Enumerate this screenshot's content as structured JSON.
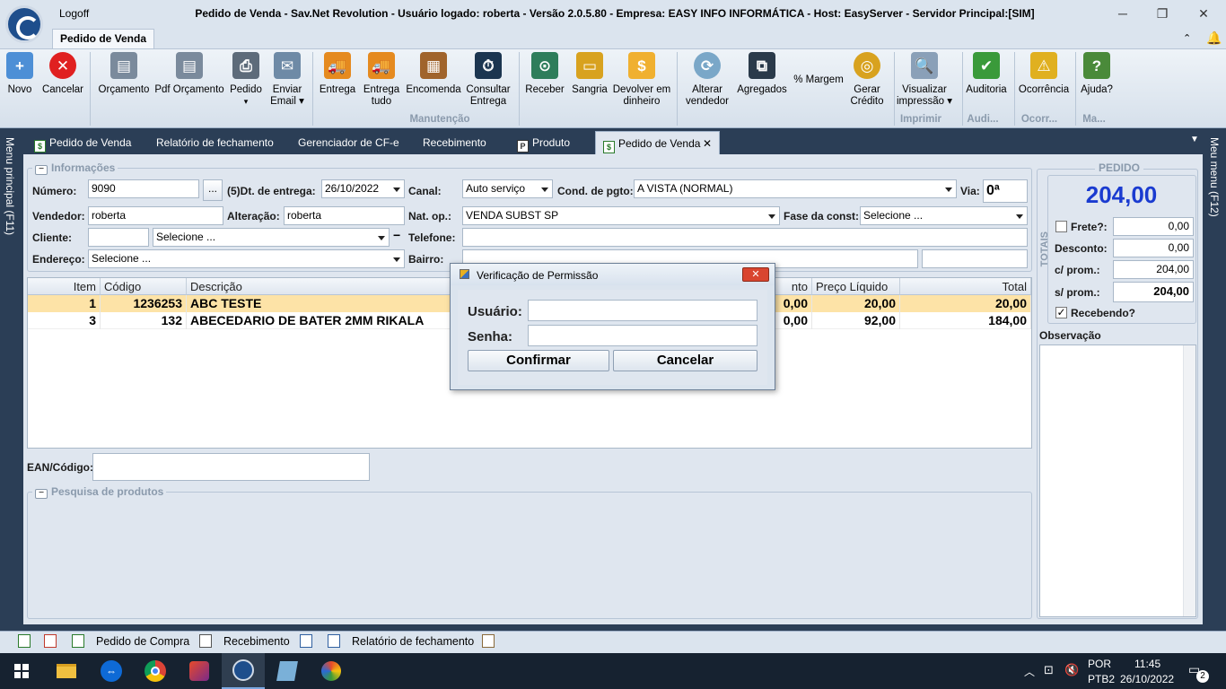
{
  "titlebar": {
    "logoff": "Logoff",
    "title": "Pedido de Venda - Sav.Net Revolution - Usuário logado: roberta - Versão 2.0.5.80 - Empresa: EASY INFO INFORMÁTICA - Host: EasyServer - Servidor Principal:[SIM]",
    "minimize": "─",
    "restore": "❐",
    "close": "✕"
  },
  "ribbon": {
    "tab": "Pedido de Venda",
    "buttons": {
      "novo": "Novo",
      "cancelar": "Cancelar",
      "orcamento": "Orçamento",
      "pdf_orcamento": "Pdf Orçamento",
      "pedido": "Pedido",
      "enviar_email_1": "Enviar",
      "enviar_email_2": "Email ▾",
      "entrega": "Entrega",
      "entrega_tudo_1": "Entrega",
      "entrega_tudo_2": "tudo",
      "encomenda": "Encomenda",
      "consultar_1": "Consultar",
      "consultar_2": "Entrega",
      "receber": "Receber",
      "sangria": "Sangria",
      "devolver_1": "Devolver em",
      "devolver_2": "dinheiro",
      "alterar_1": "Alterar",
      "alterar_2": "vendedor",
      "agregados": "Agregados",
      "margem": "% Margem",
      "gerar_1": "Gerar",
      "gerar_2": "Crédito",
      "visualizar_1": "Visualizar",
      "visualizar_2": "impressão ▾",
      "auditoria": "Auditoria",
      "ocorrencia": "Ocorrência",
      "ajuda": "Ajuda?"
    },
    "groups": {
      "manutencao": "Manutenção",
      "imprimir": "Imprimir",
      "audi": "Audi...",
      "ocorr": "Ocorr...",
      "ma": "Ma..."
    }
  },
  "side": {
    "left": "Menu principal (F11)",
    "right": "Meu menu (F12)"
  },
  "doctabs": [
    "Pedido de Venda",
    "Relatório de fechamento",
    "Gerenciador de CF-e",
    "Recebimento",
    "Produto",
    "Pedido de Venda"
  ],
  "informacoes": {
    "title": "Informações",
    "numero_label": "Número:",
    "numero": "9090",
    "dots": "...",
    "dt_entrega_label": "(5)Dt. de entrega:",
    "dt_entrega": "26/10/2022",
    "canal_label": "Canal:",
    "canal": "Auto serviço",
    "cond_label": "Cond. de pgto:",
    "cond": "A VISTA (NORMAL)",
    "via_label": "Via:",
    "via": "0ª",
    "vendedor_label": "Vendedor:",
    "vendedor": "roberta",
    "alteracao_label": "Alteração:",
    "alteracao": "roberta",
    "natop_label": "Nat. op.:",
    "natop": "VENDA SUBST SP",
    "fase_label": "Fase da const:",
    "fase": "Selecione ...",
    "cliente_label": "Cliente:",
    "cliente": "",
    "cliente_sel": "Selecione ...",
    "telefone_label": "Telefone:",
    "telefone": "",
    "endereco_label": "Endereço:",
    "endereco": "Selecione ...",
    "bairro_label": "Bairro:",
    "bairro": ""
  },
  "grid": {
    "headers": [
      "Item",
      "Código",
      "Descrição",
      "nto",
      "Preço Líquido",
      "Total"
    ],
    "rows": [
      [
        "1",
        "1236253",
        "ABC TESTE",
        "0,00",
        "20,00",
        "20,00"
      ],
      [
        "3",
        "132",
        "ABECEDARIO DE BATER 2MM RIKALA",
        "0,00",
        "92,00",
        "184,00"
      ]
    ]
  },
  "ean": {
    "label": "EAN/Código:",
    "value": ""
  },
  "pesquisa": {
    "title": "Pesquisa de produtos"
  },
  "dialog": {
    "title": "Verificação de Permissão",
    "usuario_label": "Usuário:",
    "senha_label": "Senha:",
    "usuario": "",
    "senha": "",
    "confirmar": "Confirmar",
    "cancelar": "Cancelar"
  },
  "pedido": {
    "title": "PEDIDO",
    "total": "204,00",
    "totais_label": "TOTAIS",
    "frete_label": "Frete?:",
    "frete": "0,00",
    "desconto_label": "Desconto:",
    "desconto": "0,00",
    "cprom_label": "c/ prom.:",
    "cprom": "204,00",
    "sprom_label": "s/ prom.:",
    "sprom": "204,00",
    "recebendo_label": "Recebendo?",
    "observacao_label": "Observação"
  },
  "bottombar": {
    "pedido_compra": "Pedido de Compra",
    "recebimento": "Recebimento",
    "relatorio": "Relatório de fechamento"
  },
  "taskbar": {
    "lang1": "POR",
    "lang2": "PTB2",
    "time": "11:45",
    "date": "26/10/2022",
    "notif": "2"
  }
}
